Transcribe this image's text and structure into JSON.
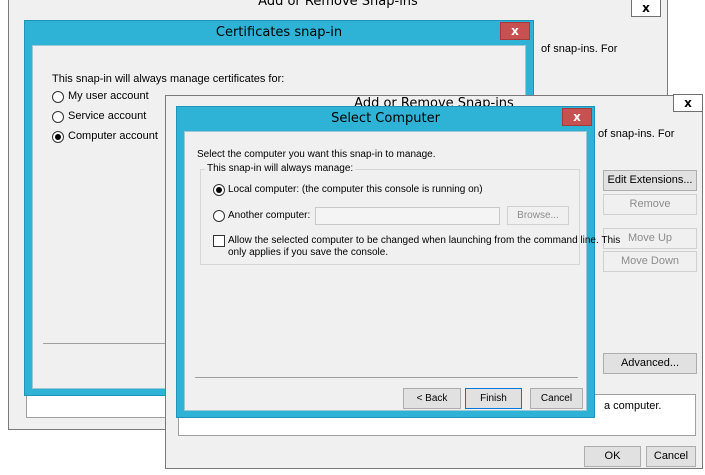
{
  "addremove_back": {
    "title": "Add or Remove Snap-ins",
    "close_label": "x",
    "desc_partial": "of snap-ins. For"
  },
  "addremove_front": {
    "title": "Add or Remove Snap-ins",
    "close_label": "x",
    "desc_partial": "of snap-ins. For",
    "buttons": {
      "edit_extensions": "Edit Extensions...",
      "remove": "Remove",
      "move_up": "Move Up",
      "move_down": "Move Down",
      "advanced": "Advanced...",
      "ok": "OK",
      "cancel": "Cancel"
    },
    "description_partial": "a computer."
  },
  "certificates": {
    "title": "Certificates snap-in",
    "close_label": "x",
    "prompt": "This snap-in will always manage certificates for:",
    "options": [
      {
        "label": "My user account",
        "selected": false
      },
      {
        "label": "Service account",
        "selected": false
      },
      {
        "label": "Computer account",
        "selected": true
      }
    ]
  },
  "select_computer": {
    "title": "Select Computer",
    "close_label": "x",
    "instruction": "Select the computer you want this snap-in to manage.",
    "group_label": "This snap-in will always manage:",
    "local_option": "Local computer:  (the computer this console is running on)",
    "another_option": "Another computer:",
    "computer_name_value": "",
    "browse_label": "Browse...",
    "allow_change_line1": "Allow the selected computer to be changed when launching from the command line.  This",
    "allow_change_line2": "only applies if you save the console.",
    "allow_change_checked": false,
    "back_label": "< Back",
    "finish_label": "Finish",
    "cancel_label": "Cancel"
  }
}
